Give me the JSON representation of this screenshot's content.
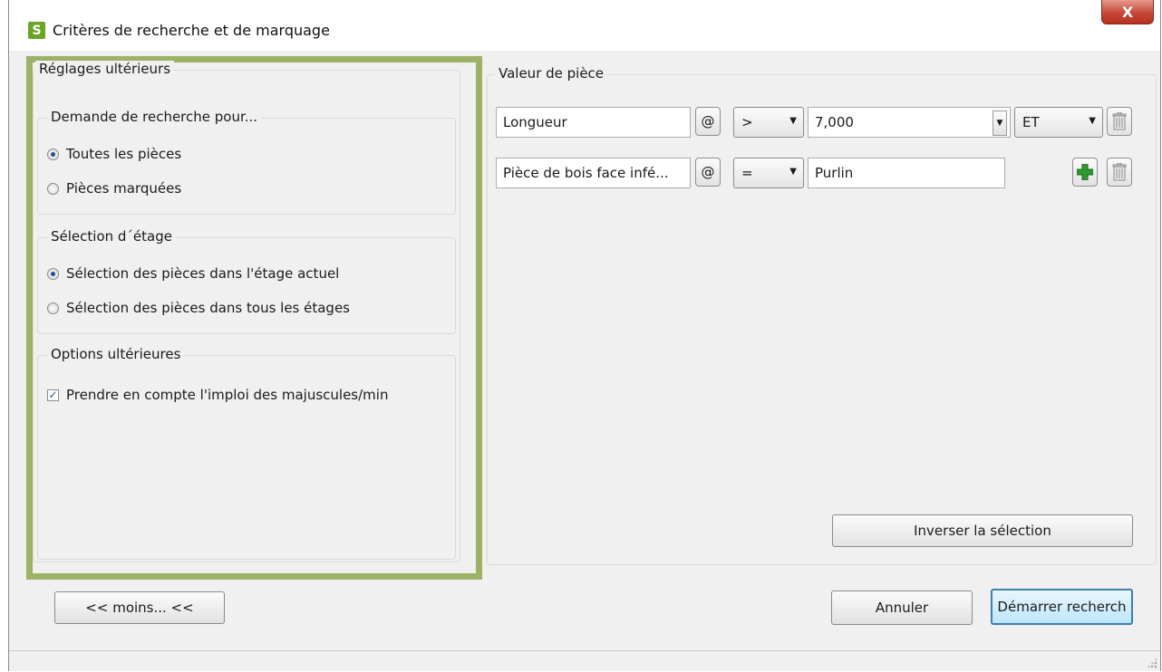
{
  "window": {
    "title": "Critères de recherche et de marquage",
    "close_label": "X"
  },
  "left": {
    "section_title": "Réglages ultérieurs",
    "search_group": {
      "title": "Demande de recherche pour...",
      "options": [
        {
          "label": "Toutes les pièces",
          "selected": true
        },
        {
          "label": "Pièces marquées",
          "selected": false
        }
      ]
    },
    "floor_group": {
      "title": "Sélection d´étage",
      "options": [
        {
          "label": "Sélection des pièces dans l'étage actuel",
          "selected": true
        },
        {
          "label": "Sélection des pièces dans tous les étages",
          "selected": false
        }
      ]
    },
    "options_group": {
      "title": "Options ultérieures",
      "case_sensitive_label": "Prendre en compte l'imploi des majuscules/min",
      "case_sensitive_checked": true
    }
  },
  "right": {
    "section_title": "Valeur de pièce",
    "rows": [
      {
        "attribute": "Longueur",
        "operator": ">",
        "value": "7,000",
        "logic": "ET"
      },
      {
        "attribute": "Pièce de bois face infé...",
        "operator": "=",
        "value": "Purlin"
      }
    ],
    "at_symbol": "@",
    "invert_label": "Inverser la sélection"
  },
  "footer": {
    "less_label": "<< moins... <<",
    "cancel_label": "Annuler",
    "start_label": "Démarrer recherch"
  },
  "colors": {
    "highlight_border": "#9cb265",
    "add_green": "#2e9a2e",
    "app_icon": "#6aa526"
  }
}
